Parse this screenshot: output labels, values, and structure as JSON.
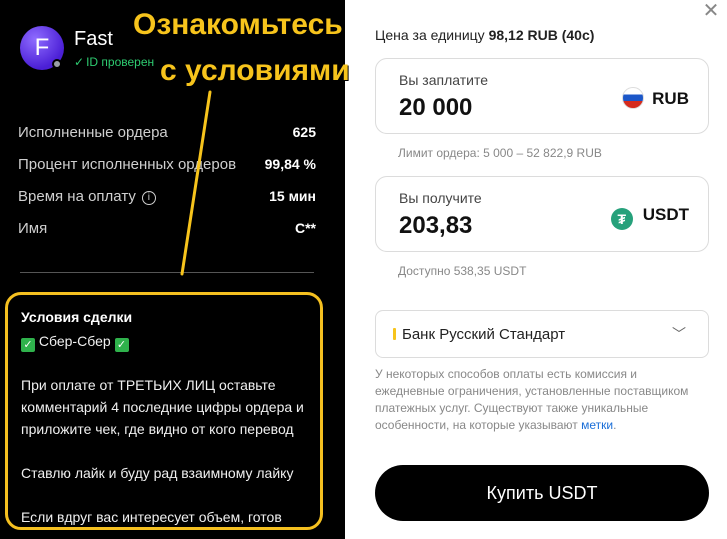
{
  "annotation": {
    "line1": "Ознакомьтесь",
    "line2": "с условиями",
    "color": "#f7c41c"
  },
  "merchant": {
    "avatar_letter": "F",
    "name": "Fast",
    "verified_label": "ID проверен"
  },
  "stats": [
    {
      "label": "Исполненные ордера",
      "value": "625"
    },
    {
      "label": "Процент исполненных ордеров",
      "value": "99,84 %"
    },
    {
      "label": "Время на оплату",
      "value": "15 мин",
      "icon": "info-icon"
    },
    {
      "label": "Имя",
      "value": "С**"
    }
  ],
  "terms": {
    "title": "Условия сделки",
    "method": "Сбер-Сбер",
    "lines": [
      " При оплате от ТРЕТЬИХ ЛИЦ оставьте",
      "комментарий 4 последние цифры ордера и",
      " приложите чек, где видно от кого перевод",
      "Ставлю лайк и буду рад взаимному лайку",
      "Если вдруг вас интересует объем, готов"
    ]
  },
  "order": {
    "price_label": "Цена за единицу",
    "price_value": "98,12 RUB (40с)",
    "pay_label": "Вы заплатите",
    "pay_amount": "20 000",
    "pay_currency": "RUB",
    "limit_text": "Лимит ордера: 5 000 – 52 822,9 RUB",
    "get_label": "Вы получите",
    "get_amount": "203,83",
    "get_currency": "USDT",
    "available_text": "Доступно 538,35 USDT",
    "bank": "Банк Русский Стандарт",
    "note_text": "У некоторых способов оплаты есть комиссия и ежедневные ограничения, установленные поставщиком платежных услуг. Существуют также уникальные особенности, на которые указывают ",
    "note_link": "метки",
    "note_end": ".",
    "buy_label": "Купить USDT"
  },
  "colors": {
    "accent_yellow": "#f5c020",
    "verified_green": "#2ecc71",
    "tether_green": "#26a17b",
    "link_blue": "#1a6ed8"
  }
}
